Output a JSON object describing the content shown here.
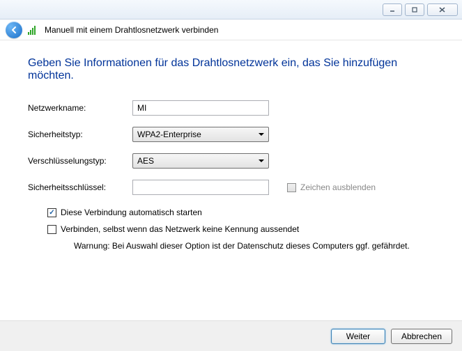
{
  "header": {
    "title": "Manuell mit einem Drahtlosnetzwerk verbinden"
  },
  "heading": "Geben Sie Informationen für das Drahtlosnetzwerk ein, das Sie hinzufügen möchten.",
  "form": {
    "network_name_label": "Netzwerkname:",
    "network_name_value": "MI",
    "security_type_label": "Sicherheitstyp:",
    "security_type_value": "WPA2-Enterprise",
    "encryption_type_label": "Verschlüsselungstyp:",
    "encryption_type_value": "AES",
    "security_key_label": "Sicherheitsschlüssel:",
    "security_key_value": "",
    "hide_chars_label": "Zeichen ausblenden"
  },
  "options": {
    "auto_start_label": "Diese Verbindung automatisch starten",
    "auto_start_checked": true,
    "connect_hidden_label": "Verbinden, selbst wenn das Netzwerk keine Kennung aussendet",
    "connect_hidden_checked": false,
    "warning": "Warnung: Bei Auswahl dieser Option ist der Datenschutz dieses Computers ggf. gefährdet."
  },
  "footer": {
    "next_label": "Weiter",
    "cancel_label": "Abbrechen"
  }
}
